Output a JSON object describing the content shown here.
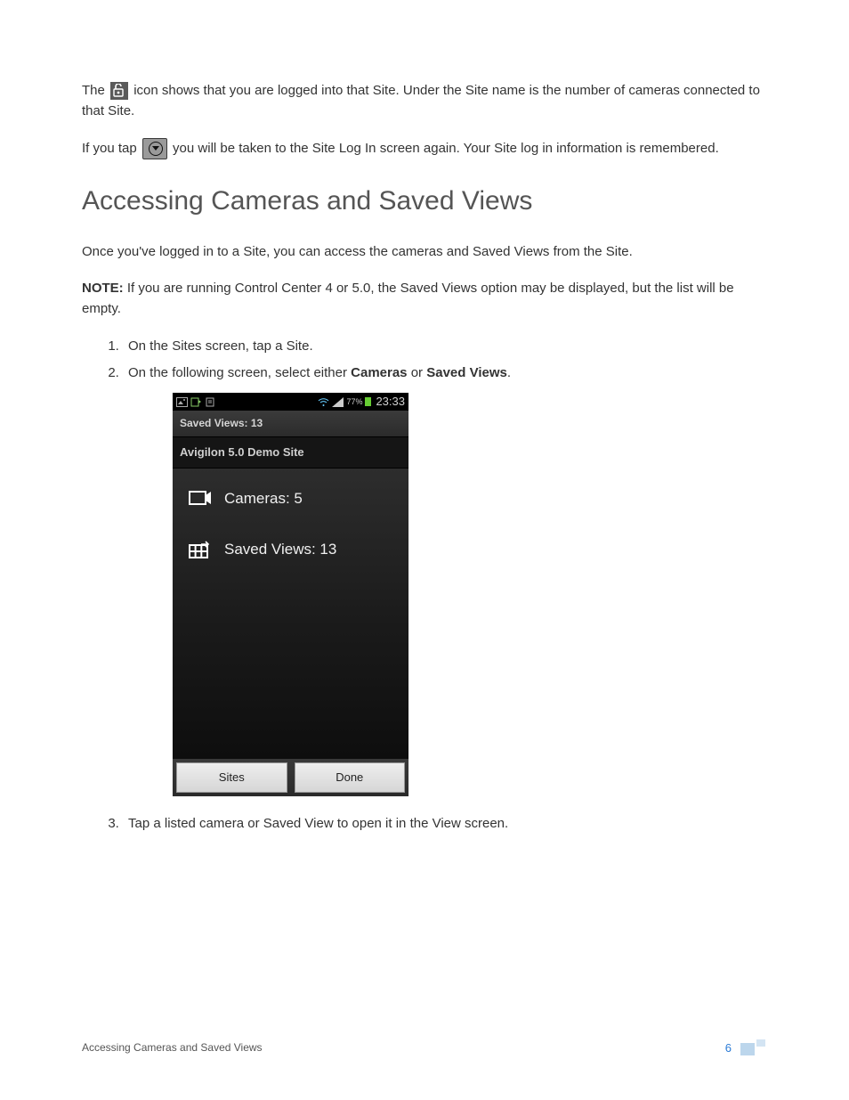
{
  "para1_a": "The ",
  "para1_b": " icon shows that you are logged into that Site. Under the Site name is the number of cameras connected to that Site.",
  "para2_a": "If you tap ",
  "para2_b": " you will be taken to the Site Log In screen again. Your Site log in information is remembered.",
  "heading": "Accessing Cameras and Saved Views",
  "para3": "Once you've logged in to a Site, you can access the cameras and Saved Views from the Site.",
  "note_label": "NOTE:",
  "note_text": " If you are running Control Center 4 or 5.0, the Saved Views option may be displayed, but the list will be empty.",
  "step1": "On the Sites screen, tap a Site.",
  "step2_a": "On the following screen, select either ",
  "step2_b": "Cameras",
  "step2_c": " or ",
  "step2_d": "Saved Views",
  "step2_e": ".",
  "step3": "Tap a listed camera or Saved View to open it in the View screen.",
  "phone": {
    "battery_pct": "77%",
    "time": "23:33",
    "titlebar": "Saved Views: 13",
    "subtitle": "Avigilon 5.0 Demo Site",
    "item_cameras": "Cameras: 5",
    "item_saved": "Saved Views: 13",
    "btn_sites": "Sites",
    "btn_done": "Done"
  },
  "footer_text": "Accessing Cameras and Saved Views",
  "page_number": "6"
}
